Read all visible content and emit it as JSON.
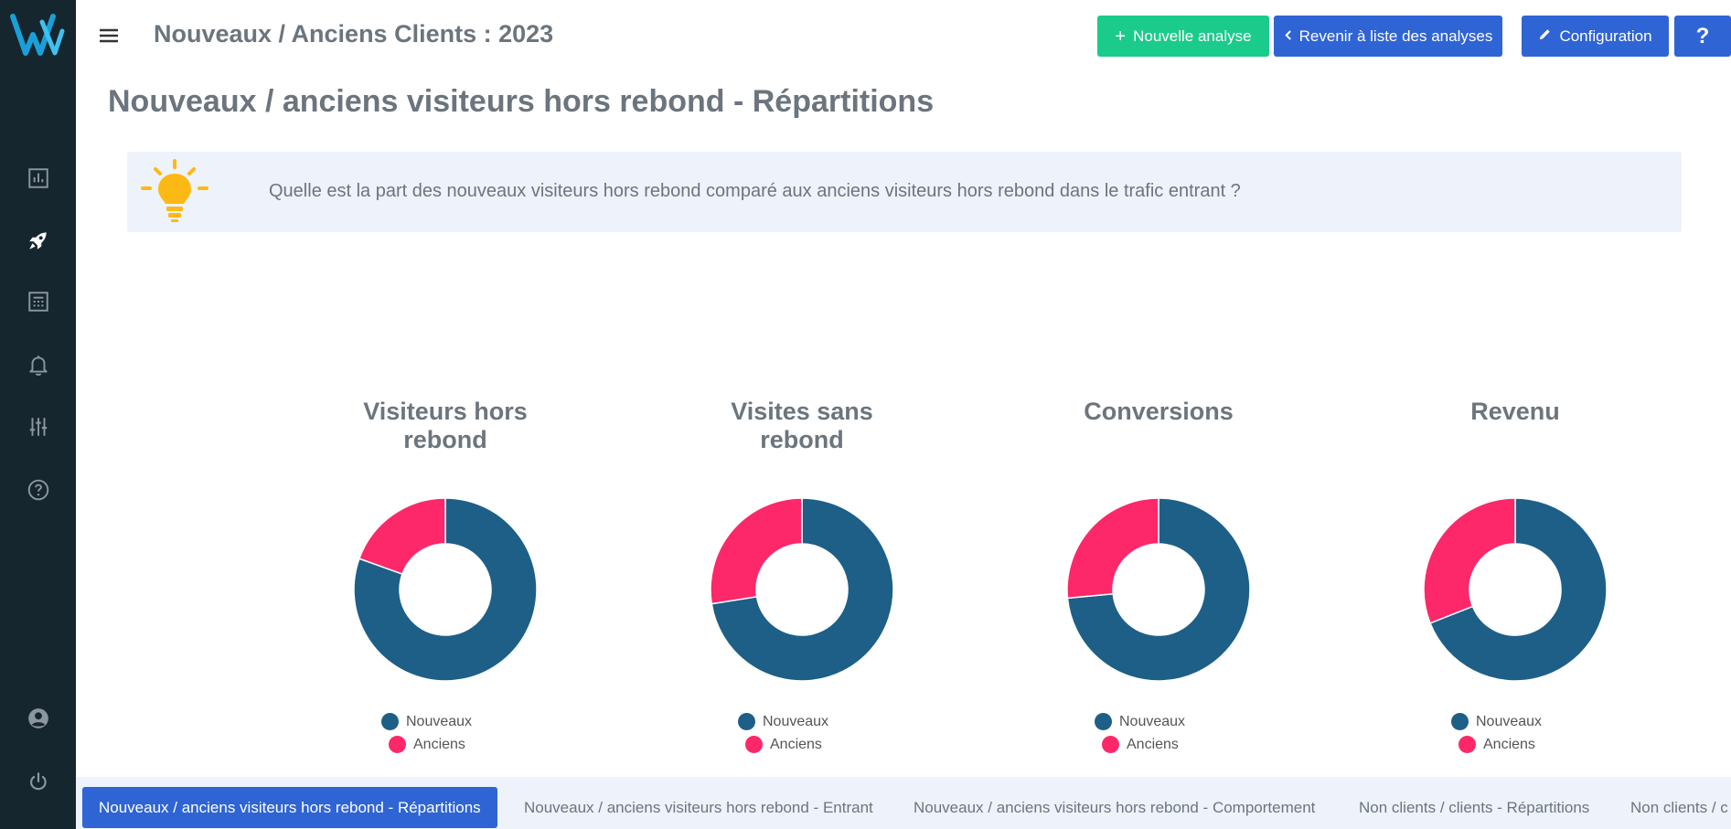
{
  "header": {
    "title": "Nouveaux / Anciens Clients : 2023",
    "new_analysis_label": "Nouvelle analyse",
    "back_label": "Revenir à liste des analyses",
    "config_label": "Configuration",
    "help_label": "?"
  },
  "sidebar": {
    "items": [
      {
        "icon": "bar-chart-icon"
      },
      {
        "icon": "rocket-icon",
        "active": true
      },
      {
        "icon": "table-icon"
      },
      {
        "icon": "bell-icon"
      },
      {
        "icon": "sliders-icon"
      },
      {
        "icon": "help-circle-icon"
      },
      {
        "icon": "user-icon"
      },
      {
        "icon": "power-icon"
      }
    ]
  },
  "page": {
    "title": "Nouveaux / anciens visiteurs hors rebond - Répartitions",
    "info": "Quelle est la part des nouveaux visiteurs hors rebond comparé aux anciens visiteurs hors rebond dans le trafic entrant ?"
  },
  "colors": {
    "nouveaux": "#1d5f87",
    "anciens": "#fc2869",
    "accent_green": "#1bcb8c",
    "accent_blue": "#2f64d4",
    "bulb": "#fdb913"
  },
  "chart_data": [
    {
      "type": "pie",
      "title": "Visiteurs hors rebond",
      "categories": [
        "Nouveaux",
        "Anciens"
      ],
      "values": [
        80.5,
        19.5
      ]
    },
    {
      "type": "pie",
      "title": "Visites sans rebond",
      "categories": [
        "Nouveaux",
        "Anciens"
      ],
      "values": [
        72.5,
        27.5
      ]
    },
    {
      "type": "pie",
      "title": "Conversions",
      "categories": [
        "Nouveaux",
        "Anciens"
      ],
      "values": [
        73.5,
        26.5
      ]
    },
    {
      "type": "pie",
      "title": "Revenu",
      "categories": [
        "Nouveaux",
        "Anciens"
      ],
      "values": [
        69,
        31
      ]
    }
  ],
  "chart_lines": [
    [
      "Visiteurs hors",
      "rebond"
    ],
    [
      "Visites sans",
      "rebond"
    ],
    [
      "Conversions"
    ],
    [
      "Revenu"
    ]
  ],
  "legend": {
    "nouveaux": "Nouveaux",
    "anciens": "Anciens"
  },
  "tabs": [
    {
      "label": "Nouveaux / anciens visiteurs hors rebond - Répartitions",
      "active": true
    },
    {
      "label": "Nouveaux / anciens visiteurs hors rebond - Entrant"
    },
    {
      "label": "Nouveaux / anciens visiteurs hors rebond - Comportement"
    },
    {
      "label": "Non clients / clients - Répartitions"
    },
    {
      "label": "Non clients / c"
    }
  ]
}
